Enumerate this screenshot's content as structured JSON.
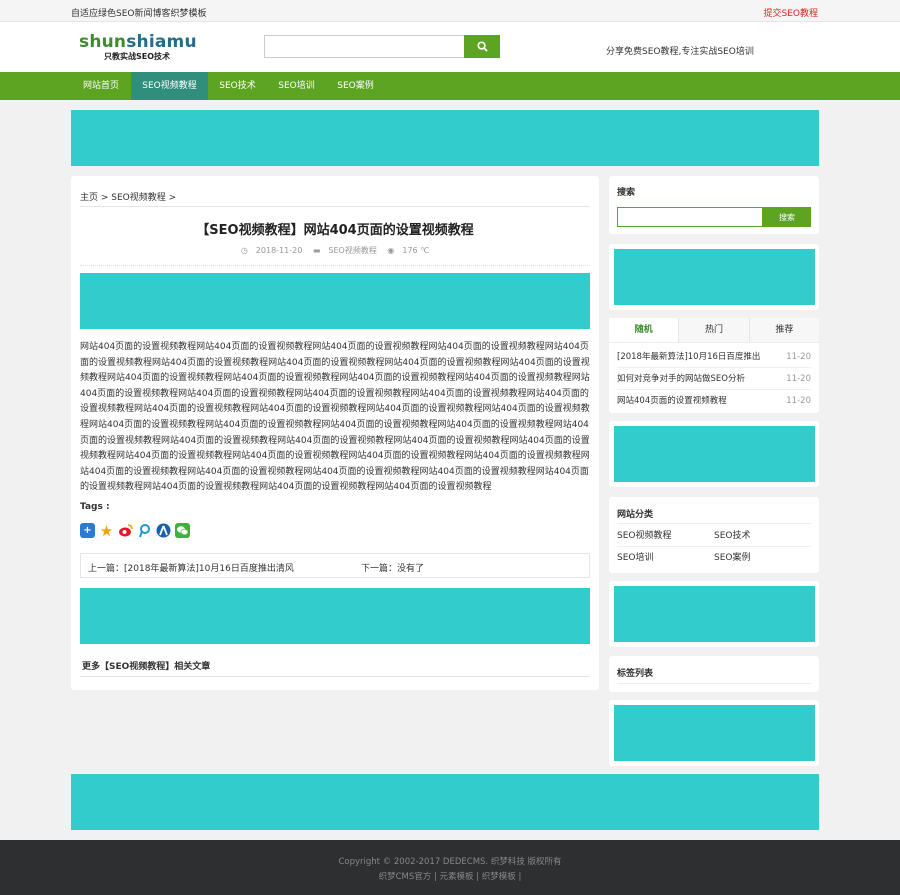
{
  "topbar": {
    "site_desc": "自适应绿色SEO新闻博客织梦模板",
    "submit_link": "提交SEO教程"
  },
  "header": {
    "logo_part1": "shun",
    "logo_part2": "shiamu",
    "logo_slogan": "只教实战SEO技术",
    "search_placeholder": "",
    "tagline": "分享免费SEO教程,专注实战SEO培训"
  },
  "nav": {
    "items": [
      {
        "label": "网站首页"
      },
      {
        "label": "SEO视频教程"
      },
      {
        "label": "SEO技术"
      },
      {
        "label": "SEO培训"
      },
      {
        "label": "SEO案例"
      }
    ]
  },
  "article": {
    "breadcrumb": "主页 > SEO视频教程 >",
    "title": "【SEO视频教程】网站404页面的设置视频教程",
    "date": "2018-11-20",
    "category": "SEO视频教程",
    "views": "176 ℃",
    "body": "网站404页面的设置视频教程网站404页面的设置视频教程网站404页面的设置视频教程网站404页面的设置视频教程网站404页面的设置视频教程网站404页面的设置视频教程网站404页面的设置视频教程网站404页面的设置视频教程网站404页面的设置视频教程网站404页面的设置视频教程网站404页面的设置视频教程网站404页面的设置视频教程网站404页面的设置视频教程网站404页面的设置视频教程网站404页面的设置视频教程网站404页面的设置视频教程网站404页面的设置视频教程网站404页面的设置视频教程网站404页面的设置视频教程网站404页面的设置视频教程网站404页面的设置视频教程网站404页面的设置视频教程网站404页面的设置视频教程网站404页面的设置视频教程网站404页面的设置视频教程网站404页面的设置视频教程网站404页面的设置视频教程网站404页面的设置视频教程网站404页面的设置视频教程网站404页面的设置视频教程网站404页面的设置视频教程网站404页面的设置视频教程网站404页面的设置视频教程网站404页面的设置视频教程网站404页面的设置视频教程网站404页面的设置视频教程网站404页面的设置视频教程网站404页面的设置视频教程网站404页面的设置视频教程网站404页面的设置视频教程网站404页面的设置视频教程网站404页面的设置视频教程网站404页面的设置视频教程",
    "tags_label": "Tags :",
    "prev": "上一篇：[2018年最新算法]10月16日百度推出清风",
    "next": "下一篇：没有了",
    "related": "更多【SEO视频教程】相关文章"
  },
  "sidebar": {
    "search_title": "搜索",
    "search_button": "搜索",
    "tabs": [
      {
        "label": "随机"
      },
      {
        "label": "热门"
      },
      {
        "label": "推荐"
      }
    ],
    "random_list": [
      {
        "title": "[2018年最新算法]10月16日百度推出",
        "date": "11-20"
      },
      {
        "title": "如何对竞争对手的网站做SEO分析",
        "date": "11-20"
      },
      {
        "title": "网站404页面的设置视频教程",
        "date": "11-20"
      }
    ],
    "cat_title": "网站分类",
    "categories": [
      "SEO视频教程",
      "SEO技术",
      "SEO培训",
      "SEO案例"
    ],
    "tags_title": "标签列表"
  },
  "footer": {
    "copyright": "Copyright © 2002-2017 DEDECMS. 织梦科技 版权所有",
    "links": "织梦CMS官方 | 元素模板 | 织梦模板 |"
  },
  "colors": {
    "green": "#5da423",
    "teal_active": "#2f8f7c",
    "ad": "#33cccc",
    "footer": "#2e2f30"
  }
}
